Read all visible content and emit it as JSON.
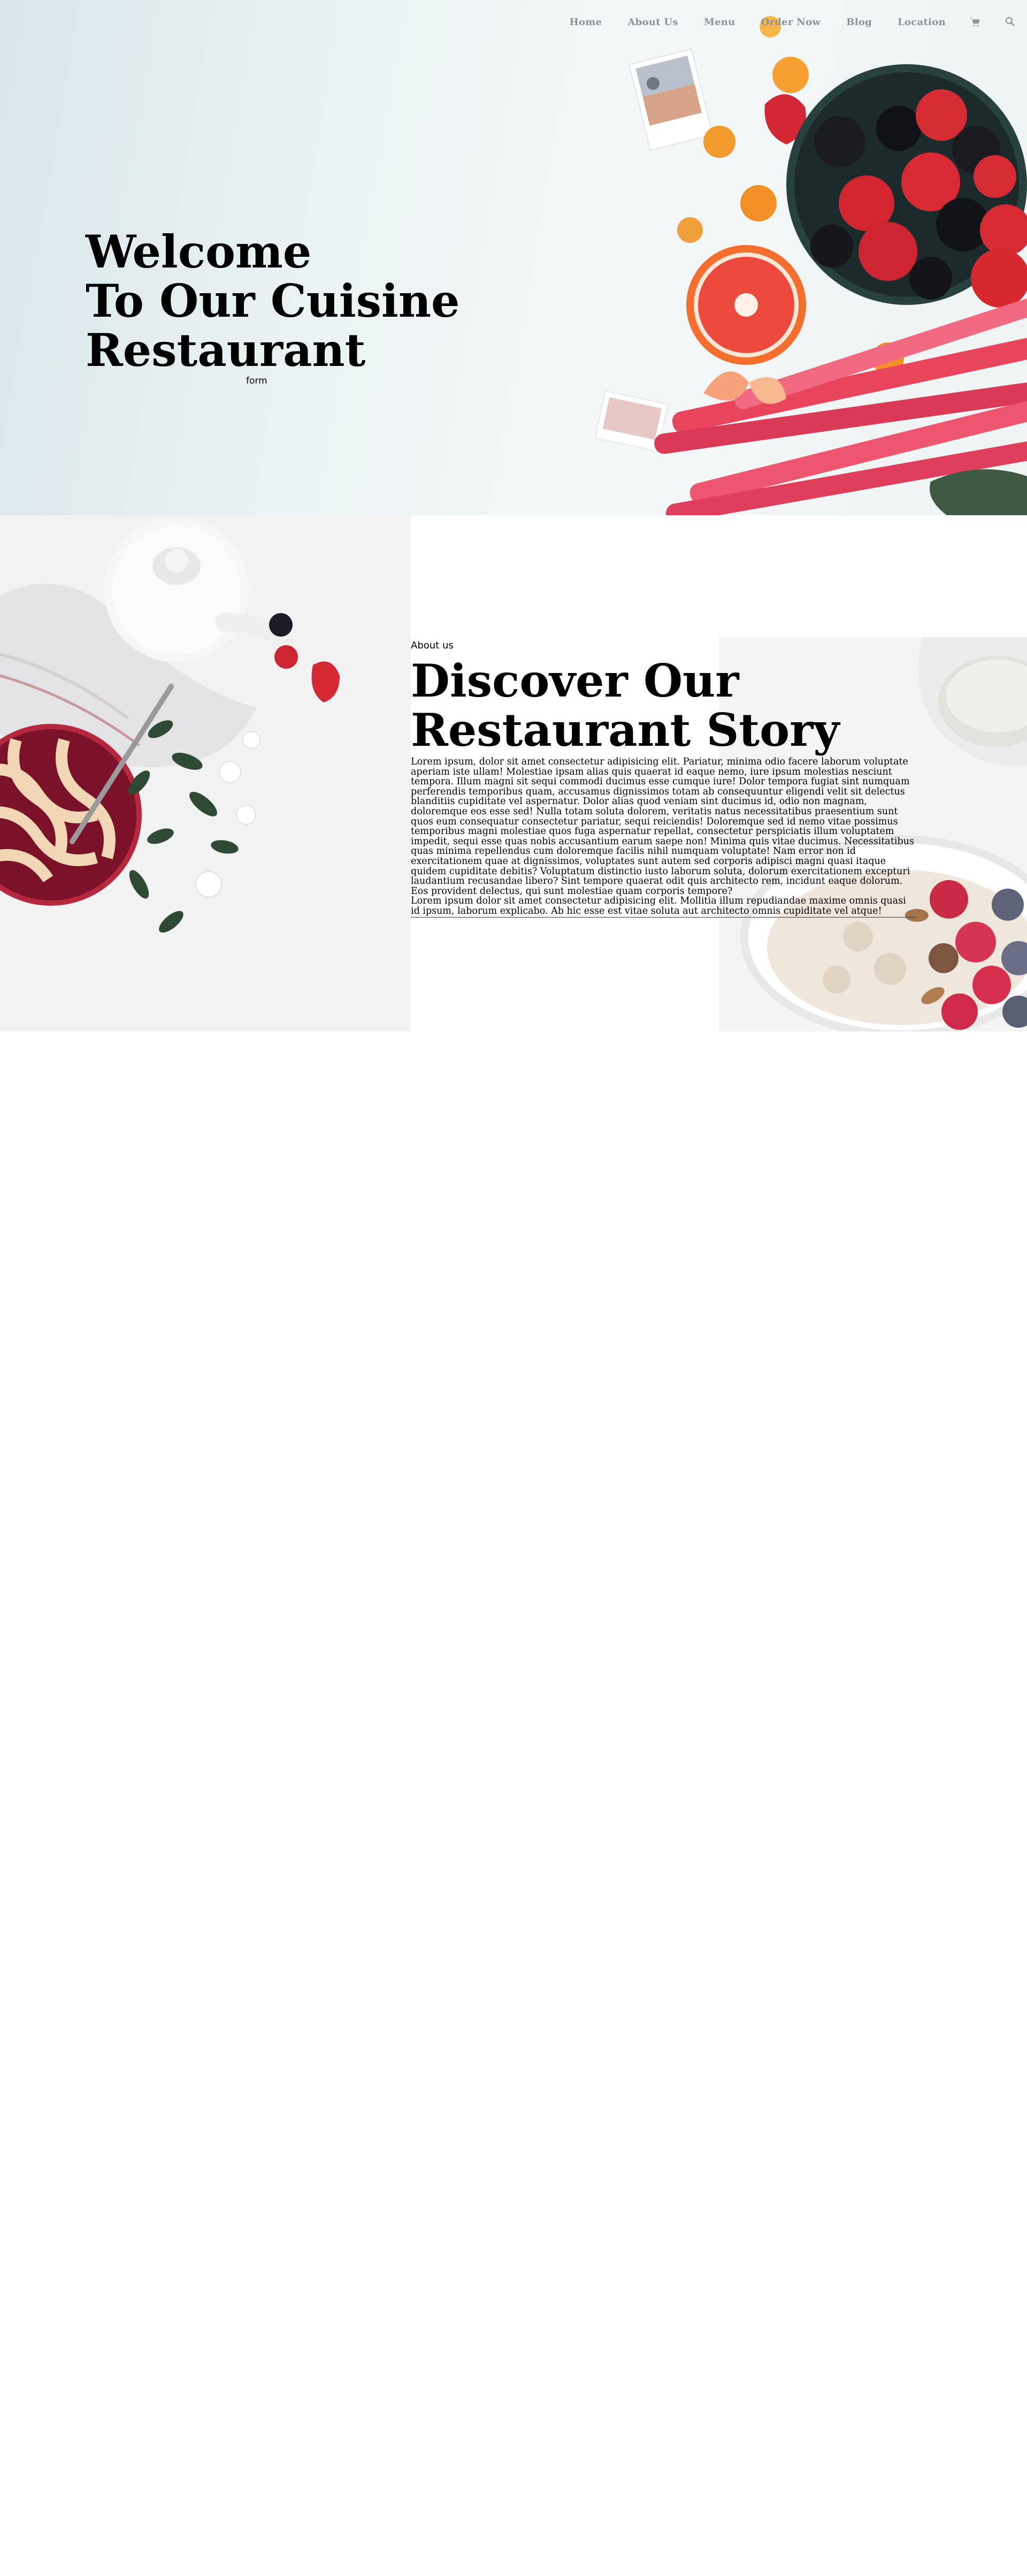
{
  "nav": {
    "items": [
      {
        "label": "Home"
      },
      {
        "label": "About Us"
      },
      {
        "label": "Menu"
      },
      {
        "label": "Order Now"
      },
      {
        "label": "Blog"
      },
      {
        "label": "Location"
      }
    ],
    "icons": [
      "cart-icon",
      "search-icon"
    ]
  },
  "hero": {
    "title_lines": [
      "Welcome",
      "To Our Cuisine",
      "Restaurant"
    ],
    "form_text": "form"
  },
  "about": {
    "kicker": "About us",
    "title_lines": [
      "Discover Our",
      "Restaurant Story"
    ],
    "paragraph_1": "Lorem ipsum, dolor sit amet consectetur adipisicing elit. Pariatur, minima odio facere laborum voluptate aperiam iste ullam! Molestiae ipsam alias quis quaerat id eaque nemo, iure ipsum molestias nesciunt tempora. Illum magni sit sequi commodi ducimus esse cumque iure! Dolor tempora fugiat sint numquam perferendis temporibus quam, accusamus dignissimos totam ab consequuntur eligendi velit sit delectus blanditiis cupiditate vel aspernatur. Dolor alias quod veniam sint ducimus id, odio non magnam, doloremque eos esse sed! Nulla totam soluta dolorem, veritatis natus necessitatibus praesentium sunt quos eum consequatur consectetur pariatur, sequi reiciendis! Doloremque sed id nemo vitae possimus temporibus magni molestiae quos fuga aspernatur repellat, consectetur perspiciatis illum voluptatem impedit, sequi esse quas nobis accusantium earum saepe non! Minima quis vitae ducimus. Necessitatibus quas minima repellendus cum doloremque facilis nihil numquam voluptate! Nam error non id exercitationem quae at dignissimos, voluptates sunt autem sed corporis adipisci magni quasi itaque quidem cupiditate debitis? Voluptatum distinctio iusto laborum soluta, dolorum exercitationem excepturi laudantium recusandae libero? Sint tempore quaerat odit quis architecto rem, incidunt eaque dolorum. Eos provident delectus, qui sunt molestiae quam corporis tempore?",
    "paragraph_2": "Lorem ipsum dolor sit amet consectetur adipisicing elit. Mollitia illum repudiandae maxime omnis quasi id ipsum, laborum explicabo. Ab hic esse est vitae soluta aut architecto omnis cupiditate vel atque!"
  },
  "colors": {
    "nav_text": "#8c9297",
    "text": "#000000",
    "background": "#ffffff"
  }
}
